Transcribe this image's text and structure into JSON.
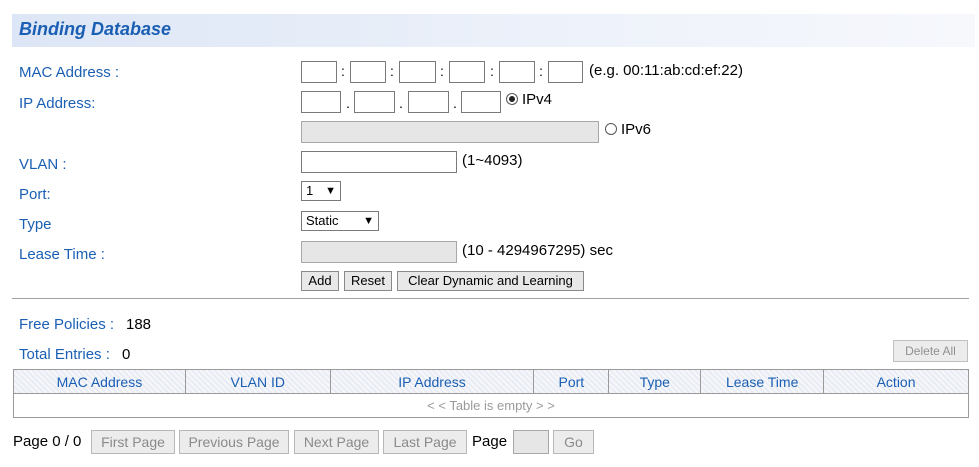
{
  "title": "Binding Database",
  "form": {
    "mac_label": "MAC Address :",
    "mac_sep": ":",
    "mac_hint": "(e.g. 00:11:ab:cd:ef:22)",
    "ip_label": "IP Address:",
    "ip_sep": ".",
    "ipv4_label": "IPv4",
    "ipv6_label": "IPv6",
    "ip_version_selected": "IPv4",
    "vlan_label": "VLAN :",
    "vlan_hint": "(1~4093)",
    "port_label": "Port:",
    "port_value": "1",
    "type_label": "Type",
    "type_value": "Static",
    "lease_label": "Lease Time :",
    "lease_hint": "(10 - 4294967295) sec",
    "add_label": "Add",
    "reset_label": "Reset",
    "clear_label": "Clear Dynamic and Learning"
  },
  "summary": {
    "free_policies_label": "Free Policies :",
    "free_policies_value": "188",
    "total_entries_label": "Total Entries :",
    "total_entries_value": "0",
    "delete_all_label": "Delete All"
  },
  "table": {
    "columns": [
      "MAC Address",
      "VLAN ID",
      "IP Address",
      "Port",
      "Type",
      "Lease Time",
      "Action"
    ],
    "empty_text": "< < Table is empty > >"
  },
  "pagination": {
    "page_info": "Page 0 / 0",
    "first_label": "First Page",
    "previous_label": "Previous Page",
    "next_label": "Next Page",
    "last_label": "Last Page",
    "page_label": "Page",
    "go_label": "Go"
  }
}
